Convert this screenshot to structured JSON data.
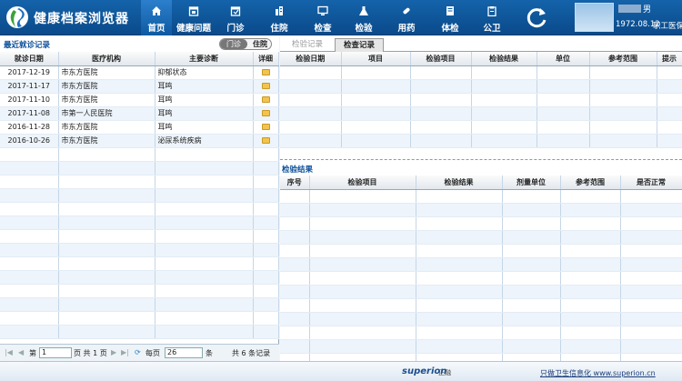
{
  "app": {
    "title": "健康档案浏览器"
  },
  "nav": [
    {
      "label": "首页",
      "icon": "home-icon"
    },
    {
      "label": "健康问题",
      "icon": "calendar-icon"
    },
    {
      "label": "门诊",
      "icon": "calendar-icon"
    },
    {
      "label": "住院",
      "icon": "building-icon"
    },
    {
      "label": "检查",
      "icon": "monitor-icon"
    },
    {
      "label": "检验",
      "icon": "flask-icon"
    },
    {
      "label": "用药",
      "icon": "pill-icon"
    },
    {
      "label": "体检",
      "icon": "book-icon"
    },
    {
      "label": "公卫",
      "icon": "clipboard-icon"
    }
  ],
  "user": {
    "gender": "男",
    "dob": "1972.08.12",
    "insurance": "职工医保"
  },
  "left": {
    "title": "最近就诊记录",
    "toggle": {
      "outpatient": "门诊",
      "inpatient": "住院"
    },
    "columns": [
      "就诊日期",
      "医疗机构",
      "主要诊断",
      "详细"
    ],
    "rows": [
      [
        "2017-12-19",
        "市东方医院",
        "抑郁状态"
      ],
      [
        "2017-11-17",
        "市东方医院",
        "耳鸣"
      ],
      [
        "2017-11-10",
        "市东方医院",
        "耳鸣"
      ],
      [
        "2017-11-08",
        "市第一人民医院",
        "耳鸣"
      ],
      [
        "2016-11-28",
        "市东方医院",
        "耳鸣"
      ],
      [
        "2016-10-26",
        "市东方医院",
        "泌尿系统疾病"
      ]
    ],
    "pager": {
      "page_prefix": "第",
      "page_value": "1",
      "page_suffix": "页 共 1 页",
      "per_page_label": "每页",
      "per_page_value": "26",
      "per_page_unit": "条",
      "total": "共 6 条记录"
    }
  },
  "right": {
    "tabs": [
      "检验记录",
      "检查记录"
    ],
    "lab_columns": [
      "检验日期",
      "项目",
      "检验项目",
      "检验结果",
      "单位",
      "参考范围",
      "提示"
    ],
    "result_title": "检验结果",
    "result_columns": [
      "序号",
      "检验项目",
      "检验结果",
      "剂量单位",
      "参考范围",
      "是否正常"
    ]
  },
  "footer": {
    "brand": "superion",
    "brand_cn": "正融",
    "link": "只做卫生信息化 www.superion.cn"
  },
  "colors": {
    "topbar": "#0f5aa0",
    "accent": "#0c4f9a"
  }
}
